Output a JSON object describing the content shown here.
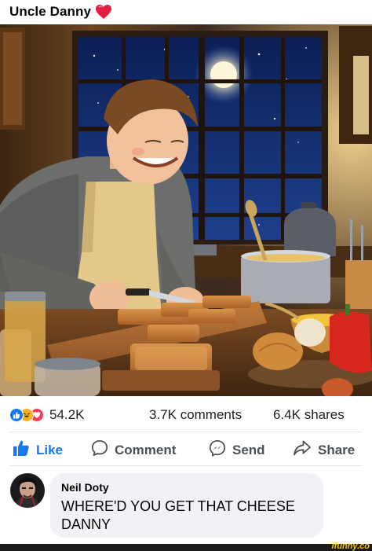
{
  "post": {
    "title": "Uncle Danny",
    "title_emoji_icon": "red-heart-icon"
  },
  "photo": {
    "icon": "photo-image"
  },
  "stats": {
    "reactions_count": "54.2K",
    "reaction_icons": [
      "like-icon",
      "haha-icon",
      "love-icon"
    ],
    "comments": "3.7K comments",
    "shares": "6.4K shares"
  },
  "actions": {
    "like_label": "Like",
    "comment_label": "Comment",
    "send_label": "Send",
    "share_label": "Share"
  },
  "comment": {
    "author": "Neil Doty",
    "text": "WHERE'D YOU GET THAT CHEESE DANNY"
  },
  "footer": {
    "watermark": "ifunny.co"
  },
  "colors": {
    "accent_blue": "#1877f2",
    "love_red": "#f33e58",
    "haha_yellow": "#f7b125",
    "watermark_yellow": "#f7c600"
  }
}
